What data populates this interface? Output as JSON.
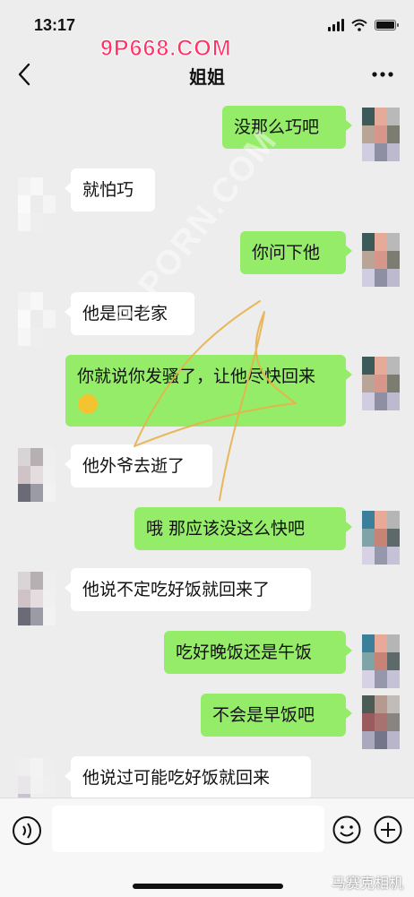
{
  "status": {
    "time": "13:17"
  },
  "header": {
    "title": "姐姐"
  },
  "watermarks": {
    "top": "9P668.COM",
    "diagonal": "91PORN.COM",
    "bottom": "马赛克相机"
  },
  "messages": [
    {
      "side": "right",
      "text": "没那么巧吧"
    },
    {
      "side": "left",
      "text": "就怕巧"
    },
    {
      "side": "right",
      "text": "你问下他"
    },
    {
      "side": "left",
      "text": "他是回老家"
    },
    {
      "side": "right",
      "text": "你就说你发骚了，让他尽快回来"
    },
    {
      "side": "left",
      "text": "他外爷去逝了"
    },
    {
      "side": "right",
      "text": "哦  那应该没这么快吧"
    },
    {
      "side": "left",
      "text": "他说不定吃好饭就回来了"
    },
    {
      "side": "right",
      "text": "吃好晚饭还是午饭"
    },
    {
      "side": "right",
      "text": "不会是早饭吧"
    },
    {
      "side": "left",
      "text": "他说过可能吃好饭就回来"
    }
  ],
  "icons": {
    "back": "chevron-left-icon",
    "more": "more-dots-icon",
    "voice": "voice-icon",
    "emoji": "emoji-icon",
    "plus": "plus-icon"
  },
  "colors": {
    "background": "#ededed",
    "bubble_right": "#95ec69",
    "bubble_left": "#ffffff",
    "watermark_pink": "#ff3366",
    "scribble": "#e8b04a"
  }
}
